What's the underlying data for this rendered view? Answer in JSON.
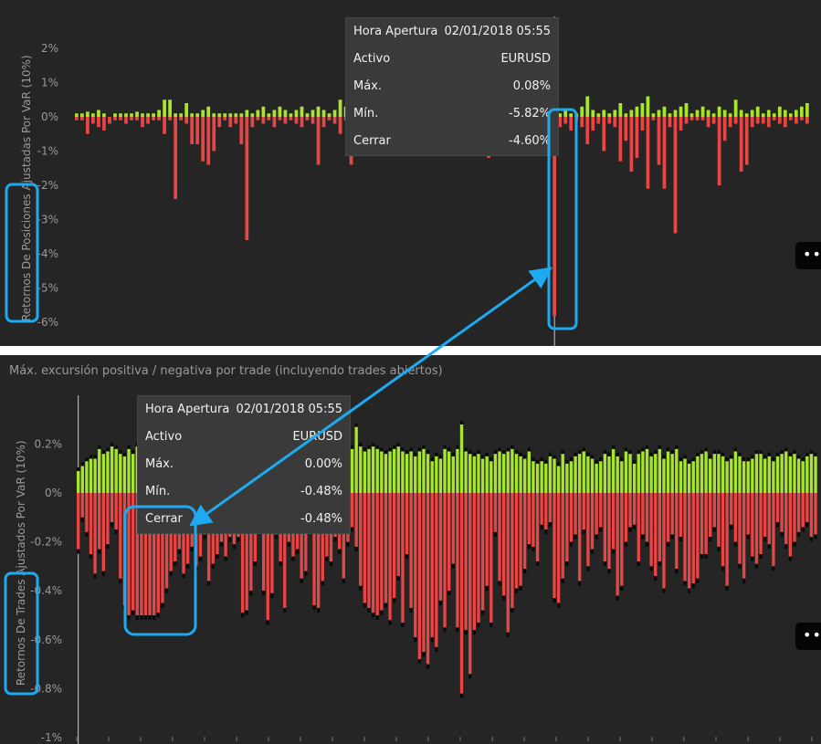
{
  "chart_data": [
    {
      "type": "bar",
      "title": "",
      "ylabel": "Retornos De Posiciones Ajustadas Por VaR (10%)",
      "ylim": [
        -6.2,
        2.2
      ],
      "yticks": [
        "2%",
        "1%",
        "0%",
        "-1%",
        "-2%",
        "-3%",
        "-4%",
        "-5%",
        "-6%"
      ],
      "tick_values": [
        2,
        1,
        0,
        -1,
        -2,
        -3,
        -4,
        -5,
        -6
      ],
      "legend": "none",
      "series": [
        {
          "name": "Máx.",
          "color": "#a8e62e",
          "values": [
            0.1,
            0.1,
            0.15,
            0.1,
            0.2,
            0.1,
            0,
            0.1,
            0.1,
            0.1,
            0.1,
            0.15,
            0.1,
            0.1,
            0.1,
            0.2,
            0.5,
            0.5,
            0.1,
            0.1,
            0.4,
            0.1,
            0.1,
            0.2,
            0.3,
            0.1,
            0.1,
            0.1,
            0.1,
            0.1,
            0.1,
            0.2,
            0.1,
            0.2,
            0.3,
            0.1,
            0.2,
            0.3,
            0.2,
            0.1,
            0.2,
            0.3,
            0.1,
            0.2,
            0.3,
            0.2,
            0.1,
            0.2,
            0.5,
            0.3,
            0.2,
            0.1,
            0.2,
            0.1,
            0.2,
            0.1,
            0.1,
            0.1,
            0.1,
            0.1,
            0.1,
            0.1,
            0.1,
            0.1,
            0.1,
            0.1,
            0.1,
            0.1,
            0.1,
            0.1,
            0.1,
            0.2,
            0.1,
            0.2,
            0.1,
            0.1,
            0.1,
            0.1,
            0.1,
            0.1,
            0.1,
            0.1,
            0.1,
            0.1,
            0.1,
            0.5,
            0.5,
            0.2,
            0.1,
            0.2,
            0.1,
            0.1,
            0.3,
            0.6,
            0.2,
            0.1,
            0.2,
            0.1,
            0.2,
            0.4,
            0.1,
            0.2,
            0.3,
            0.4,
            0.6,
            0.1,
            0.2,
            0.3,
            0.1,
            0.2,
            0.3,
            0.4,
            0.1,
            0.2,
            0.3,
            0.2,
            0.1,
            0.3,
            0.2,
            0.1,
            0.5,
            0.2,
            0.1,
            0.2,
            0.3,
            0.1,
            0.2,
            0.1,
            0.3,
            0.2,
            0.1,
            0.2,
            0.3,
            0.4
          ]
        },
        {
          "name": "Mín.",
          "color": "#e84545",
          "values": [
            -0.1,
            -0.1,
            -0.5,
            -0.2,
            -0.3,
            -0.4,
            -0.2,
            -0.1,
            -0.1,
            -0.2,
            -0.1,
            -0.1,
            -0.3,
            -0.2,
            -0.1,
            -0.1,
            -0.5,
            -0.1,
            -2.4,
            -0.1,
            -0.2,
            -0.8,
            -0.8,
            -1.3,
            -1.4,
            -1.0,
            -0.3,
            -0.1,
            -0.3,
            -0.2,
            -0.8,
            -3.6,
            -0.3,
            -0.1,
            -0.2,
            -0.1,
            -0.3,
            -0.1,
            -0.2,
            -0.1,
            -0.2,
            -0.3,
            -0.1,
            -0.2,
            -1.4,
            -0.3,
            -0.1,
            -0.2,
            -0.5,
            -0.1,
            -1.4,
            -0.3,
            -0.2,
            -0.1,
            -0.5,
            -0.1,
            -0.2,
            -1.0,
            -0.1,
            -0.1,
            -0.2,
            -0.1,
            -0.1,
            -0.1,
            -0.1,
            -0.1,
            -0.1,
            -0.1,
            -0.1,
            -0.1,
            -0.1,
            -0.1,
            -0.1,
            -0.1,
            -0.1,
            -1.2,
            -0.1,
            -0.1,
            -0.1,
            -0.1,
            -0.1,
            -0.1,
            -0.1,
            -0.1,
            -0.1,
            -0.3,
            -0.2,
            -5.82,
            -0.3,
            -0.2,
            -0.4,
            -0.1,
            -0.3,
            -0.8,
            -0.4,
            -0.2,
            -1.0,
            -0.2,
            -0.3,
            -1.3,
            -0.7,
            -1.6,
            -1.2,
            -0.4,
            -2.1,
            -0.1,
            -1.4,
            -2.1,
            -0.3,
            -3.4,
            -0.4,
            -0.2,
            -0.1,
            -0.1,
            -0.1,
            -0.3,
            -0.2,
            -2.0,
            -0.7,
            -0.3,
            -0.2,
            -1.6,
            -1.4,
            -0.3,
            -0.2,
            -0.2,
            -0.3,
            -0.1,
            -0.2,
            -0.3,
            -0.1,
            -0.2,
            -0.1,
            -0.2
          ]
        }
      ],
      "highlight_index": 87
    },
    {
      "type": "bar",
      "title": "Máx. excursión positiva / negativa por trade (incluyendo trades abiertos)",
      "ylabel": "Retornos De Trades Ajustados Por VaR (10%)",
      "ylim": [
        -1.0,
        0.33
      ],
      "yticks": [
        "0.2%",
        "0%",
        "-0.2%",
        "-0.4%",
        "-0.6%",
        "-0.8%",
        "-1%"
      ],
      "tick_values": [
        0.2,
        0,
        -0.2,
        -0.4,
        -0.6,
        -0.8,
        -1.0
      ],
      "legend": "none",
      "series": [
        {
          "name": "Máx.",
          "color": "#a8e62e",
          "values": [
            0.09,
            0.11,
            0.13,
            0.14,
            0.14,
            0.18,
            0.16,
            0.17,
            0.19,
            0.18,
            0.16,
            0.15,
            0.18,
            0.16,
            0.19,
            0.15,
            0.17,
            0.16,
            0.18,
            0.14,
            0.13,
            0.13,
            0.15,
            0.17,
            0.18,
            0.16,
            0.17,
            0.15,
            0.17,
            0.16,
            0.18,
            0.16,
            0.15,
            0.13,
            0.16,
            0.17,
            0.15,
            0.16,
            0.15,
            0.17,
            0.18,
            0.17,
            0.18,
            0.16,
            0.14,
            0.13,
            0.16,
            0.17,
            0.16,
            0.19,
            0.18,
            0.13,
            0.15,
            0.17,
            0.16,
            0.15,
            0.17,
            0.15,
            0.16,
            0.16,
            0.17,
            0.15,
            0.13,
            0.17,
            0.16,
            0.18,
            0.27,
            0.19,
            0.17,
            0.18,
            0.19,
            0.18,
            0.17,
            0.16,
            0.17,
            0.18,
            0.19,
            0.17,
            0.16,
            0.17,
            0.15,
            0.17,
            0.18,
            0.16,
            0.13,
            0.15,
            0.14,
            0.18,
            0.17,
            0.15,
            0.18,
            0.28,
            0.17,
            0.16,
            0.15,
            0.16,
            0.14,
            0.15,
            0.13,
            0.16,
            0.17,
            0.16,
            0.17,
            0.18,
            0.16,
            0.15,
            0.14,
            0.17,
            0.13,
            0.12,
            0.13,
            0.12,
            0.15,
            0.14,
            0.11,
            0.16,
            0.12,
            0.13,
            0.15,
            0.16,
            0.17,
            0.15,
            0.14,
            0.12,
            0.13,
            0.16,
            0.15,
            0.18,
            0.15,
            0.13,
            0.17,
            0.16,
            0.12,
            0.16,
            0.17,
            0.18,
            0.15,
            0.16,
            0.18,
            0.14,
            0.17,
            0.16,
            0.18,
            0.13,
            0.14,
            0.12,
            0.13,
            0.15,
            0.16,
            0.17,
            0.14,
            0.16,
            0.16,
            0.15,
            0.13,
            0.14,
            0.17,
            0.15,
            0.13,
            0.13,
            0.14,
            0.16,
            0.16,
            0.14,
            0.15,
            0.13,
            0.15,
            0.16,
            0.17,
            0.15,
            0.16,
            0.14,
            0.13,
            0.15,
            0.16,
            0.15,
            0.14,
            0.17,
            0.18,
            0.15,
            0.14,
            0.13
          ]
        },
        {
          "name": "Mín.",
          "color": "#e84545",
          "values": [
            -0.23,
            -0.1,
            -0.16,
            -0.25,
            -0.33,
            -0.23,
            -0.32,
            -0.21,
            -0.12,
            -0.15,
            -0.35,
            -0.46,
            -0.5,
            -0.48,
            -0.5,
            -0.5,
            -0.5,
            -0.5,
            -0.5,
            -0.49,
            -0.45,
            -0.39,
            -0.32,
            -0.28,
            -0.23,
            -0.33,
            -0.29,
            -0.22,
            -0.3,
            -0.26,
            -0.17,
            -0.36,
            -0.29,
            -0.25,
            -0.2,
            -0.26,
            -0.18,
            -0.21,
            -0.18,
            -0.49,
            -0.48,
            -0.4,
            -0.28,
            -0.13,
            -0.4,
            -0.52,
            -0.41,
            -0.17,
            -0.28,
            -0.47,
            -0.2,
            -0.26,
            -0.23,
            -0.35,
            -0.32,
            -0.13,
            -0.46,
            -0.47,
            -0.36,
            -0.26,
            -0.28,
            -0.18,
            -0.23,
            -0.35,
            -0.2,
            -0.14,
            -0.22,
            -0.38,
            -0.45,
            -0.47,
            -0.49,
            -0.5,
            -0.48,
            -0.45,
            -0.52,
            -0.43,
            -0.34,
            -0.53,
            -0.25,
            -0.47,
            -0.59,
            -0.68,
            -0.65,
            -0.7,
            -0.59,
            -0.63,
            -0.44,
            -0.55,
            -0.4,
            -0.29,
            -0.55,
            -0.82,
            -0.56,
            -0.74,
            -0.56,
            -0.53,
            -0.48,
            -0.38,
            -0.53,
            -0.16,
            -0.36,
            -0.42,
            -0.57,
            -0.47,
            -0.39,
            -0.38,
            -0.31,
            -0.21,
            -0.22,
            -0.28,
            -0.13,
            -0.15,
            -0.12,
            -0.43,
            -0.45,
            -0.35,
            -0.28,
            -0.2,
            -0.17,
            -0.36,
            -0.15,
            -0.3,
            -0.23,
            -0.17,
            -0.14,
            -0.28,
            -0.31,
            -0.23,
            -0.42,
            -0.38,
            -0.2,
            -0.14,
            -0.13,
            -0.28,
            -0.17,
            -0.2,
            -0.3,
            -0.34,
            -0.28,
            -0.39,
            -0.2,
            -0.17,
            -0.31,
            -0.18,
            -0.36,
            -0.39,
            -0.37,
            -0.35,
            -0.25,
            -0.25,
            -0.18,
            -0.14,
            -0.22,
            -0.3,
            -0.38,
            -0.13,
            -0.2,
            -0.29,
            -0.35,
            -0.17,
            -0.26,
            -0.29,
            -0.25,
            -0.18,
            -0.21,
            -0.3,
            -0.12,
            -0.16,
            -0.21,
            -0.26,
            -0.2,
            -0.16,
            -0.14,
            -0.12,
            -0.18,
            -0.17
          ]
        }
      ],
      "highlight_index": 0
    }
  ],
  "tooltip_top": {
    "rows": [
      {
        "label": "Hora Apertura",
        "value": "02/01/2018 05:55"
      },
      {
        "label": "Activo",
        "value": "EURUSD"
      },
      {
        "label": "Máx.",
        "value": "0.08%"
      },
      {
        "label": "Mín.",
        "value": "-5.82%"
      },
      {
        "label": "Cerrar",
        "value": "-4.60%"
      }
    ]
  },
  "tooltip_bottom": {
    "rows": [
      {
        "label": "Hora Apertura",
        "value": "02/01/2018 05:55"
      },
      {
        "label": "Activo",
        "value": "EURUSD"
      },
      {
        "label": "Máx.",
        "value": "0.00%"
      },
      {
        "label": "Mín.",
        "value": "-0.48%"
      },
      {
        "label": "Cerrar",
        "value": "-0.48%"
      }
    ]
  },
  "more_button": {
    "label": "•••"
  },
  "colors": {
    "positive": "#a8e62e",
    "negative": "#e84545",
    "cap": "#0a0a0a",
    "background": "#252525",
    "axis_text": "#9a9a9a",
    "annotation": "#1eaaf1"
  }
}
